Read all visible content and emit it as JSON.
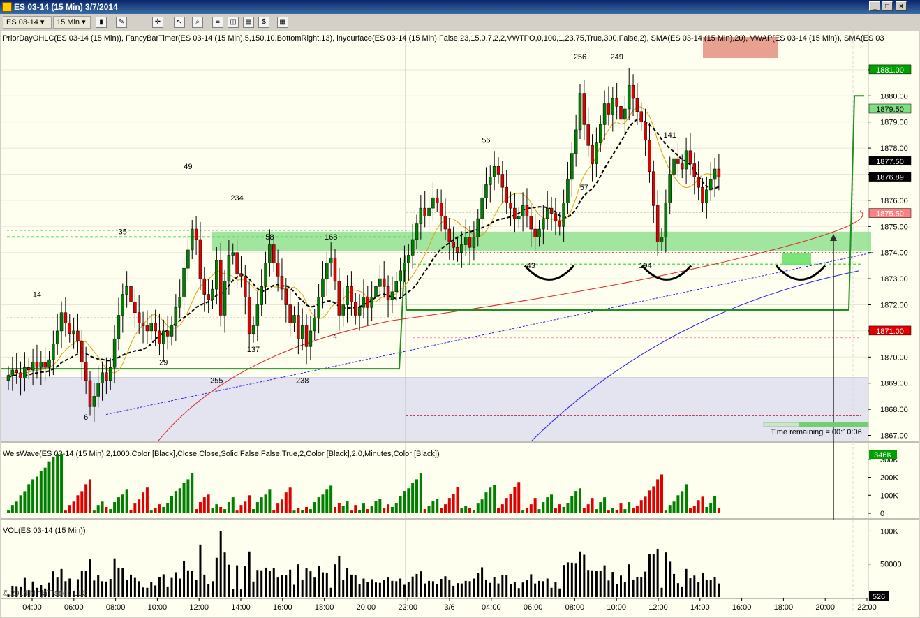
{
  "window": {
    "title": "ES 03-14 (15 Min)  3/7/2014",
    "minimize": "_",
    "maximize": "□",
    "close": "×"
  },
  "toolbar": {
    "instrument": "ES 03-14",
    "interval": "15 Min"
  },
  "panel_price": {
    "indicators_label": "PriorDayOHLC(ES 03-14 (15 Min)), FancyBarTimer(ES 03-14 (15 Min),5,150,10,BottomRight,13), inyourface(ES 03-14 (15 Min),False,23,15,0.7,2,2,VWTPO,0,100,1,23.75,True,300,False,2), SMA(ES 03-14 (15 Min),20), VWAP(ES 03-14 (15 Min)), SMA(ES 03",
    "time_remaining": "Time remaining = 00:10:06"
  },
  "panel_weis": {
    "label": "WeisWave(ES 03-14 (15 Min),2,1000,Color [Black],Close,Close,Solid,False,False,True,2,Color [Black],2,0,Minutes,Color [Black])"
  },
  "panel_vol": {
    "label": "VOL(ES 03-14 (15 Min))"
  },
  "copyright": "© 2014 NinjaTrader, LLC",
  "colors": {
    "up": "#008000",
    "down": "#e00000",
    "zone": "#90e090",
    "sma": "#e0a000",
    "vwap": "#000000",
    "red_ma": "#e02020",
    "blue_ma": "#2020e0"
  },
  "chart_data": [
    {
      "type": "candlestick",
      "title": "ES 03-14 (15 Min)",
      "ylim": [
        1866.8,
        1882.2
      ],
      "y_ticks": [
        "1867.00",
        "1868.00",
        "1869.00",
        "1870.00",
        "1871.00",
        "1872.00",
        "1873.00",
        "1874.00",
        "1875.00",
        "1876.00",
        "1877.00",
        "1878.00",
        "1879.00",
        "1880.00",
        "1881.00"
      ],
      "x_ticks": [
        "04:00",
        "06:00",
        "08:00",
        "10:00",
        "12:00",
        "14:00",
        "16:00",
        "18:00",
        "20:00",
        "22:00",
        "3/6",
        "04:00",
        "06:00",
        "08:00",
        "10:00",
        "12:00",
        "14:00",
        "16:00",
        "18:00",
        "20:00",
        "22:00"
      ],
      "price_labels": [
        {
          "text": "1881.00",
          "value": 1881.0,
          "bg": "#00a000"
        },
        {
          "text": "1879.50",
          "value": 1879.5,
          "bg": "#80e080"
        },
        {
          "text": "1877.50",
          "value": 1877.5,
          "bg": "#000000"
        },
        {
          "text": "1876.89",
          "value": 1876.89,
          "bg": "#000000"
        },
        {
          "text": "1875.50",
          "value": 1875.5,
          "bg": "#ff8080"
        },
        {
          "text": "1871.00",
          "value": 1871.0,
          "bg": "#e00000"
        }
      ],
      "swing_labels": [
        {
          "text": "14",
          "x": 7,
          "y": 1872.3
        },
        {
          "text": "6",
          "x": 19,
          "y": 1867.6
        },
        {
          "text": "35",
          "x": 28,
          "y": 1874.7
        },
        {
          "text": "29",
          "x": 38,
          "y": 1869.7
        },
        {
          "text": "49",
          "x": 44,
          "y": 1877.2
        },
        {
          "text": "255",
          "x": 51,
          "y": 1869.0
        },
        {
          "text": "234",
          "x": 56,
          "y": 1876.0
        },
        {
          "text": "137",
          "x": 60,
          "y": 1870.2
        },
        {
          "text": "58",
          "x": 64,
          "y": 1874.5
        },
        {
          "text": "238",
          "x": 72,
          "y": 1869.0
        },
        {
          "text": "168",
          "x": 79,
          "y": 1874.5
        },
        {
          "text": "4",
          "x": 80,
          "y": 1870.7
        },
        {
          "text": "56",
          "x": 117,
          "y": 1878.2
        },
        {
          "text": "43",
          "x": 128,
          "y": 1873.4
        },
        {
          "text": "57",
          "x": 141,
          "y": 1876.4
        },
        {
          "text": "256",
          "x": 140,
          "y": 1881.4
        },
        {
          "text": "249",
          "x": 149,
          "y": 1881.4
        },
        {
          "text": "194",
          "x": 156,
          "y": 1873.4
        },
        {
          "text": "141",
          "x": 162,
          "y": 1878.4
        }
      ],
      "zone": {
        "from": 1874.05,
        "to": 1874.8
      },
      "closes": [
        1869.3,
        1869.5,
        1869.4,
        1869.2,
        1869.6,
        1869.5,
        1869.8,
        1869.6,
        1869.8,
        1869.6,
        1869.9,
        1870.5,
        1871.0,
        1871.7,
        1871.3,
        1870.9,
        1871.0,
        1870.6,
        1869.8,
        1869.1,
        1868.1,
        1868.5,
        1869.0,
        1869.4,
        1869.1,
        1869.6,
        1870.7,
        1871.6,
        1872.4,
        1872.7,
        1872.1,
        1871.7,
        1871.3,
        1871.2,
        1871.0,
        1871.3,
        1871.0,
        1870.5,
        1871.0,
        1870.8,
        1871.2,
        1871.9,
        1872.3,
        1873.4,
        1874.1,
        1874.9,
        1874.5,
        1873.0,
        1872.4,
        1872.2,
        1872.6,
        1873.7,
        1871.6,
        1872.9,
        1873.9,
        1874.0,
        1873.2,
        1873.1,
        1872.3,
        1870.9,
        1871.2,
        1872.0,
        1872.7,
        1873.6,
        1874.3,
        1873.6,
        1873.1,
        1872.6,
        1872.0,
        1871.3,
        1871.6,
        1870.7,
        1871.2,
        1870.4,
        1871.0,
        1871.5,
        1872.3,
        1873.0,
        1873.6,
        1873.8,
        1872.9,
        1871.6,
        1872.0,
        1872.7,
        1872.1,
        1871.6,
        1871.9,
        1872.3,
        1871.9,
        1872.3,
        1872.7,
        1873.0,
        1872.7,
        1872.2,
        1872.5,
        1872.9,
        1873.3,
        1873.6,
        1873.9,
        1874.5,
        1875.1,
        1875.7,
        1875.4,
        1875.7,
        1876.1,
        1875.9,
        1875.4,
        1874.9,
        1874.4,
        1874.2,
        1874.0,
        1874.3,
        1874.6,
        1874.2,
        1874.6,
        1875.3,
        1876.1,
        1876.6,
        1876.9,
        1877.3,
        1877.0,
        1876.5,
        1875.9,
        1875.7,
        1875.3,
        1875.4,
        1875.8,
        1875.4,
        1874.9,
        1874.6,
        1874.9,
        1875.3,
        1875.7,
        1875.5,
        1875.2,
        1875.0,
        1875.9,
        1876.8,
        1877.8,
        1878.7,
        1880.1,
        1878.9,
        1878.1,
        1877.4,
        1878.2,
        1878.9,
        1879.7,
        1879.3,
        1879.9,
        1879.6,
        1879.1,
        1879.5,
        1880.4,
        1879.9,
        1879.4,
        1879.0,
        1878.3,
        1877.1,
        1875.8,
        1874.4,
        1874.6,
        1875.9,
        1877.0,
        1877.6,
        1877.4,
        1877.2,
        1877.9,
        1877.4,
        1876.9,
        1876.5,
        1875.9,
        1876.4,
        1876.8,
        1877.2,
        1876.9
      ]
    },
    {
      "type": "bar",
      "title": "WeisWave",
      "ylim": [
        0,
        350
      ],
      "y_ticks": [
        "0",
        "100K",
        "200K",
        "300K"
      ],
      "last_value_label": "346K"
    },
    {
      "type": "bar",
      "title": "VOL",
      "ylim": [
        0,
        110
      ],
      "y_ticks": [
        "50000",
        "100K"
      ],
      "last_value_label": "526"
    }
  ]
}
